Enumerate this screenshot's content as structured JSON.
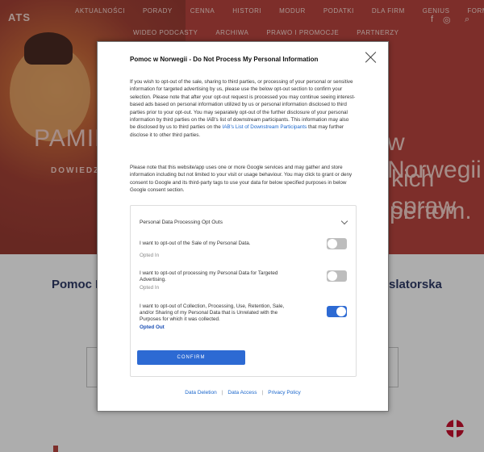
{
  "site": {
    "logo": "ATS",
    "nav_row1": [
      "AKTUALNOŚCI",
      "PORADY",
      "CENNA",
      "HISTORI",
      "MODUR",
      "PODATKI",
      "DLA FIRM",
      "GENIUS",
      "FORMULARZE"
    ],
    "nav_row2": [
      "WIDEO PODCASTY",
      "ARCHIWA",
      "PRAWO I PROMOCJE",
      "PARTNERZY"
    ],
    "social_icons": [
      "facebook-icon",
      "instagram-icon",
      "search-icon"
    ],
    "hero_title_left": "PAMIĘTA",
    "hero_subtitle_left": "DOWIEDZ S",
    "hero_title_right_1": "w Norwegii",
    "hero_title_right_2": "kich spraw",
    "hero_title_right_3": "pertom.",
    "section_title_left": "Pomoc P",
    "section_title_right": "slatorska",
    "accent_color": "#b8453e"
  },
  "consent": {
    "title": "Pomoc w Norwegii - Do Not Process My Personal Information",
    "para1": "If you wish to opt-out of the sale, sharing to third parties, or processing of your personal or sensitive information for targeted advertising by us, please use the below opt-out section to confirm your selection. Please note that after your opt-out request is processed you may continue seeing interest-based ads based on personal information utilized by us or personal information disclosed to third parties prior to your opt-out. You may separately opt-out of the further disclosure of your personal information by third parties on the IAB's list of downstream participants. This information may also be disclosed by us to third parties on the ",
    "para1_link": "IAB's List of Downstream Participants",
    "para1_end": " that may further disclose it to other third parties.",
    "para2": "Please note that this website/app uses one or more Google services and may gather and store information including but not limited to your visit or usage behaviour. You may click to grant or deny consent to Google and its third-party tags to use your data for below specified purposes in below Google consent section.",
    "options_header": "Personal Data Processing Opt Outs",
    "options": [
      {
        "label": "I want to opt-out of the Sale of my Personal Data.",
        "state": "Opted In",
        "on": false
      },
      {
        "label": "I want to opt-out of processing my Personal Data for Targeted Advertising.",
        "state": "Opted In",
        "on": false
      },
      {
        "label": "I want to opt-out of Collection, Processing, Use, Retention, Sale, and/or Sharing of my Personal Data that is Unrelated with the Purposes for which it was collected.",
        "state": "Opted Out",
        "on": true
      }
    ],
    "confirm_label": "CONFIRM",
    "footer_links": [
      "Data Deletion",
      "Data Access",
      "Privacy Policy"
    ],
    "toggle_on_color": "#2d6ad3",
    "link_color": "#1a66cc"
  }
}
